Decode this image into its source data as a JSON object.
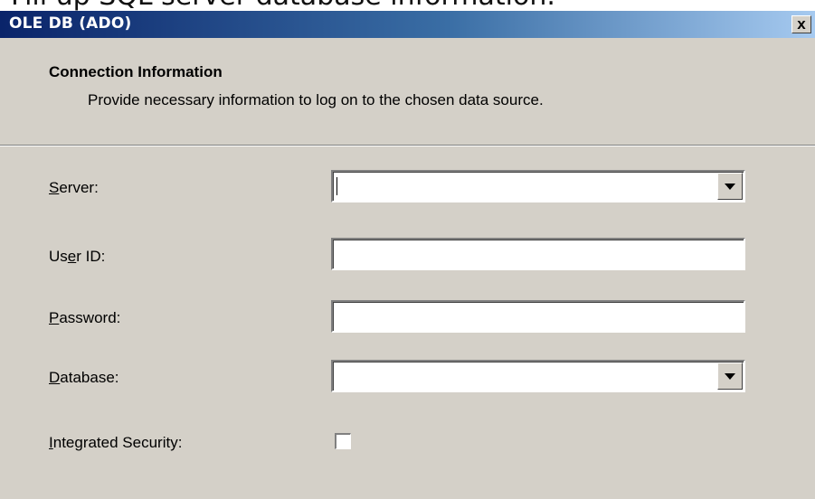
{
  "caption": {
    "text": "Fill up SQL server database information."
  },
  "window": {
    "title": "OLE DB (ADO)",
    "close_glyph": "x"
  },
  "header": {
    "title": "Connection Information",
    "subtitle": "Provide necessary information to log on to the chosen data source."
  },
  "form": {
    "server": {
      "label_mnemonic": "S",
      "label_rest": "erver:",
      "value": ""
    },
    "user_id": {
      "label_start": "Us",
      "label_mnemonic": "e",
      "label_rest": "r ID:",
      "value": ""
    },
    "password": {
      "label_mnemonic": "P",
      "label_rest": "assword:",
      "value": ""
    },
    "database": {
      "label_mnemonic": "D",
      "label_rest": "atabase:",
      "value": ""
    },
    "integrated_security": {
      "label_mnemonic": "I",
      "label_rest": "ntegrated Security:",
      "checked": false
    }
  },
  "colors": {
    "dialog_bg": "#d4d0c8",
    "titlebar_start": "#0a246a",
    "titlebar_end": "#a6caf0"
  }
}
